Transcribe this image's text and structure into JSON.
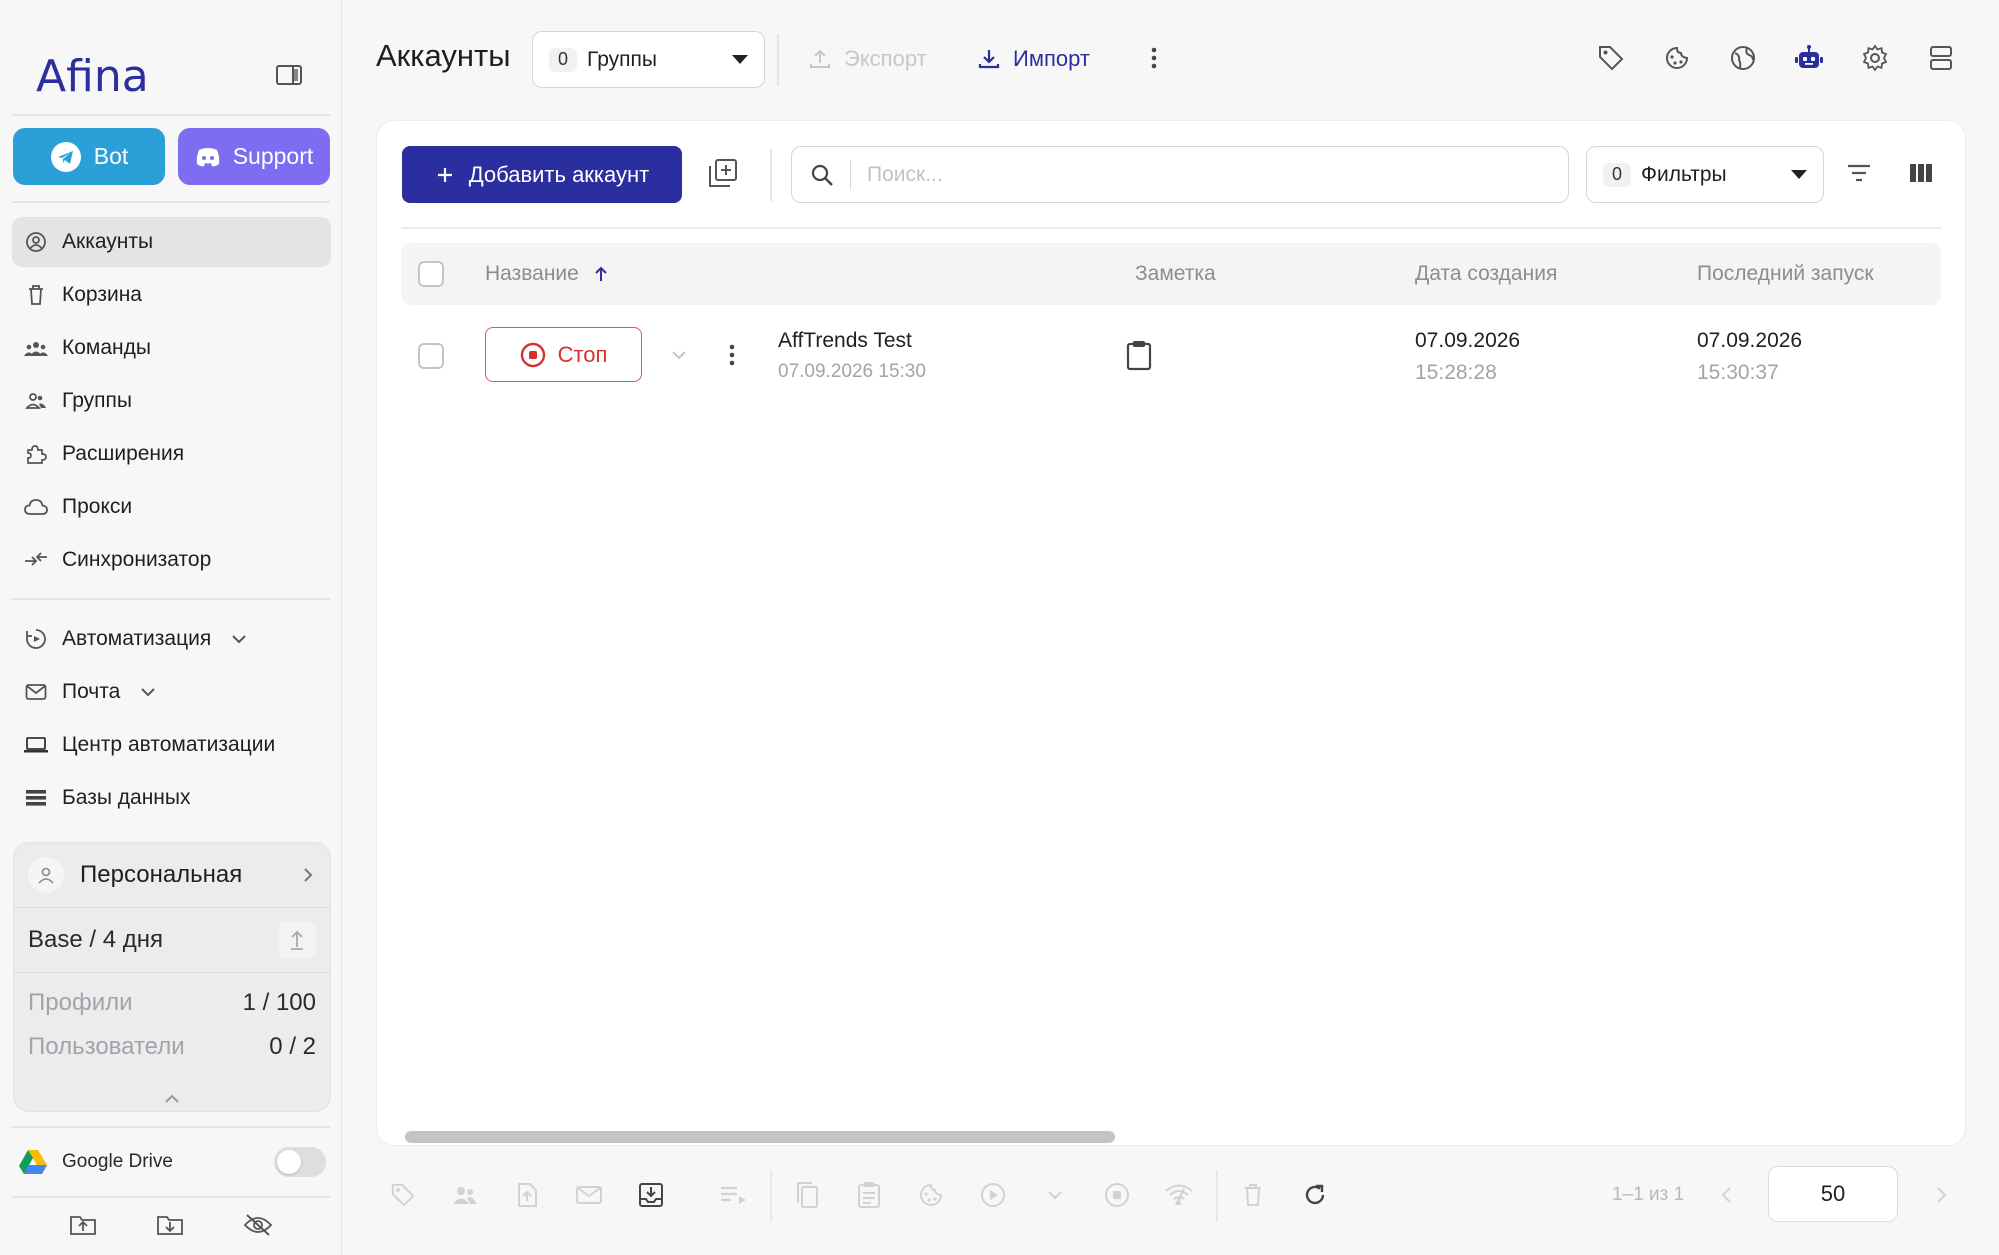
{
  "brand": {
    "logo_text": "Afina"
  },
  "sidebar": {
    "bot_label": "Bot",
    "support_label": "Support",
    "items": [
      {
        "label": "Аккаунты",
        "icon": "user-circle-icon",
        "active": true
      },
      {
        "label": "Корзина",
        "icon": "trash-icon"
      },
      {
        "label": "Команды",
        "icon": "team-icon"
      },
      {
        "label": "Группы",
        "icon": "group-icon"
      },
      {
        "label": "Расширения",
        "icon": "puzzle-icon"
      },
      {
        "label": "Прокси",
        "icon": "cloud-icon"
      },
      {
        "label": "Синхронизатор",
        "icon": "sync-icon"
      }
    ],
    "items2": [
      {
        "label": "Автоматизация",
        "icon": "automation-icon",
        "expandable": true
      },
      {
        "label": "Почта",
        "icon": "mail-icon",
        "expandable": true
      },
      {
        "label": "Центр автоматизации",
        "icon": "laptop-icon"
      },
      {
        "label": "Базы данных",
        "icon": "database-icon"
      }
    ],
    "plan": {
      "workspace": "Персональная",
      "tier": "Base / 4 дня",
      "profiles_label": "Профили",
      "profiles_value": "1 / 100",
      "users_label": "Пользователи",
      "users_value": "0 / 2"
    },
    "gdrive_label": "Google Drive",
    "gdrive_enabled": false
  },
  "header": {
    "title": "Аккаунты",
    "groups_count": "0",
    "groups_label": "Группы",
    "export_label": "Экспорт",
    "import_label": "Импорт"
  },
  "toolbar": {
    "add_label": "Добавить аккаунт",
    "search_placeholder": "Поиск...",
    "filters_count": "0",
    "filters_label": "Фильтры"
  },
  "table": {
    "columns": [
      "Название",
      "Заметка",
      "Дата создания",
      "Последний запуск"
    ],
    "rows": [
      {
        "status_label": "Стоп",
        "name": "AffTrends Test",
        "subtitle": "07.09.2026 15:30",
        "created_date": "07.09.2026",
        "created_time": "15:28:28",
        "last_date": "07.09.2026",
        "last_time": "15:30:37"
      }
    ]
  },
  "pagination": {
    "range_text": "1–1 из 1",
    "per_page": "50"
  },
  "colors": {
    "accent": "#2b2e9e",
    "telegram": "#2a9fd8",
    "discord": "#7e6cf1",
    "stop": "#d7312f"
  }
}
